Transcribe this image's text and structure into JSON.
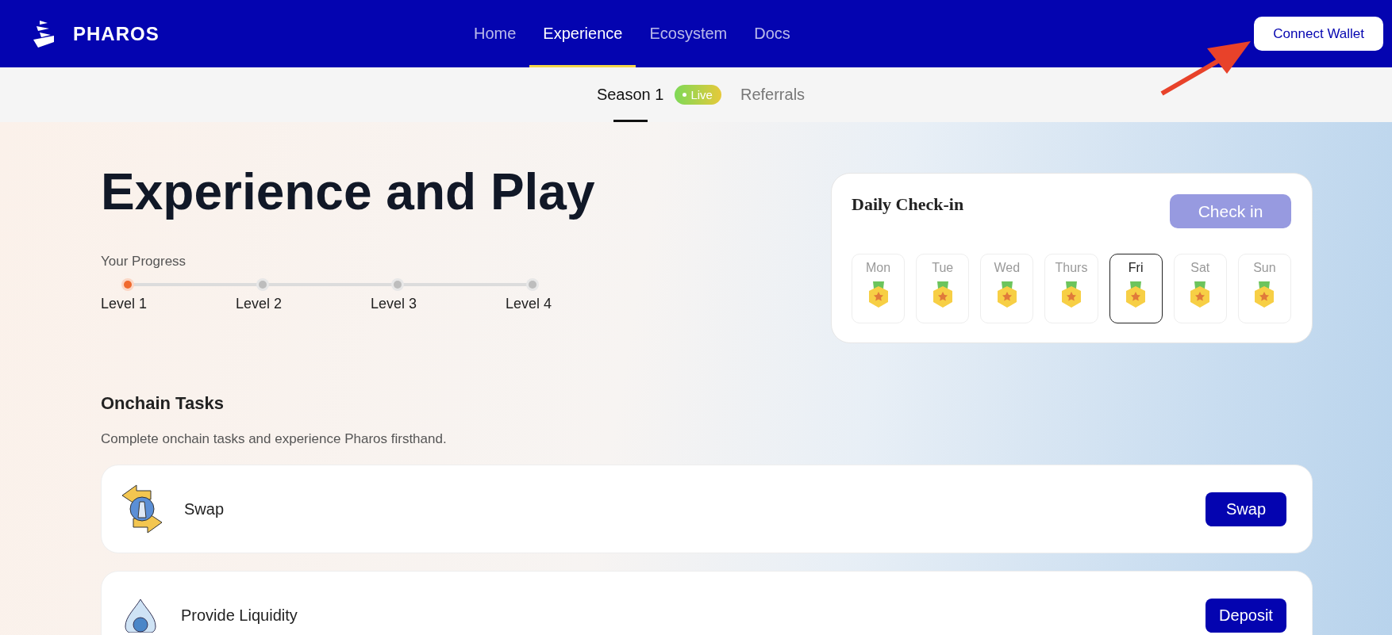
{
  "brand": {
    "name": "PHAROS"
  },
  "nav": [
    {
      "label": "Home",
      "selected": false
    },
    {
      "label": "Experience",
      "selected": true
    },
    {
      "label": "Ecosystem",
      "selected": false
    },
    {
      "label": "Docs",
      "selected": false
    }
  ],
  "connect_button": "Connect Wallet",
  "subnav": [
    {
      "label": "Season 1",
      "selected": true,
      "badge": "Live"
    },
    {
      "label": "Referrals",
      "selected": false
    }
  ],
  "title": "Experience and Play",
  "progress": {
    "label": "Your Progress",
    "levels": [
      {
        "label": "Level 1",
        "selected": true
      },
      {
        "label": "Level 2",
        "selected": false
      },
      {
        "label": "Level 3",
        "selected": false
      },
      {
        "label": "Level 4",
        "selected": false
      }
    ]
  },
  "checkin": {
    "title": "Daily Check-in",
    "button": {
      "label": "Check in",
      "disabled": true
    },
    "days": [
      {
        "label": "Mon",
        "selected": false
      },
      {
        "label": "Tue",
        "selected": false
      },
      {
        "label": "Wed",
        "selected": false
      },
      {
        "label": "Thurs",
        "selected": false
      },
      {
        "label": "Fri",
        "selected": true
      },
      {
        "label": "Sat",
        "selected": false
      },
      {
        "label": "Sun",
        "selected": false
      }
    ]
  },
  "tasks": {
    "title": "Onchain Tasks",
    "subtitle": "Complete onchain tasks and experience Pharos firsthand.",
    "items": [
      {
        "kind": "swap",
        "title": "Swap",
        "button": "Swap"
      },
      {
        "kind": "liquidity",
        "title": "Provide Liquidity",
        "button": "Deposit"
      }
    ]
  }
}
